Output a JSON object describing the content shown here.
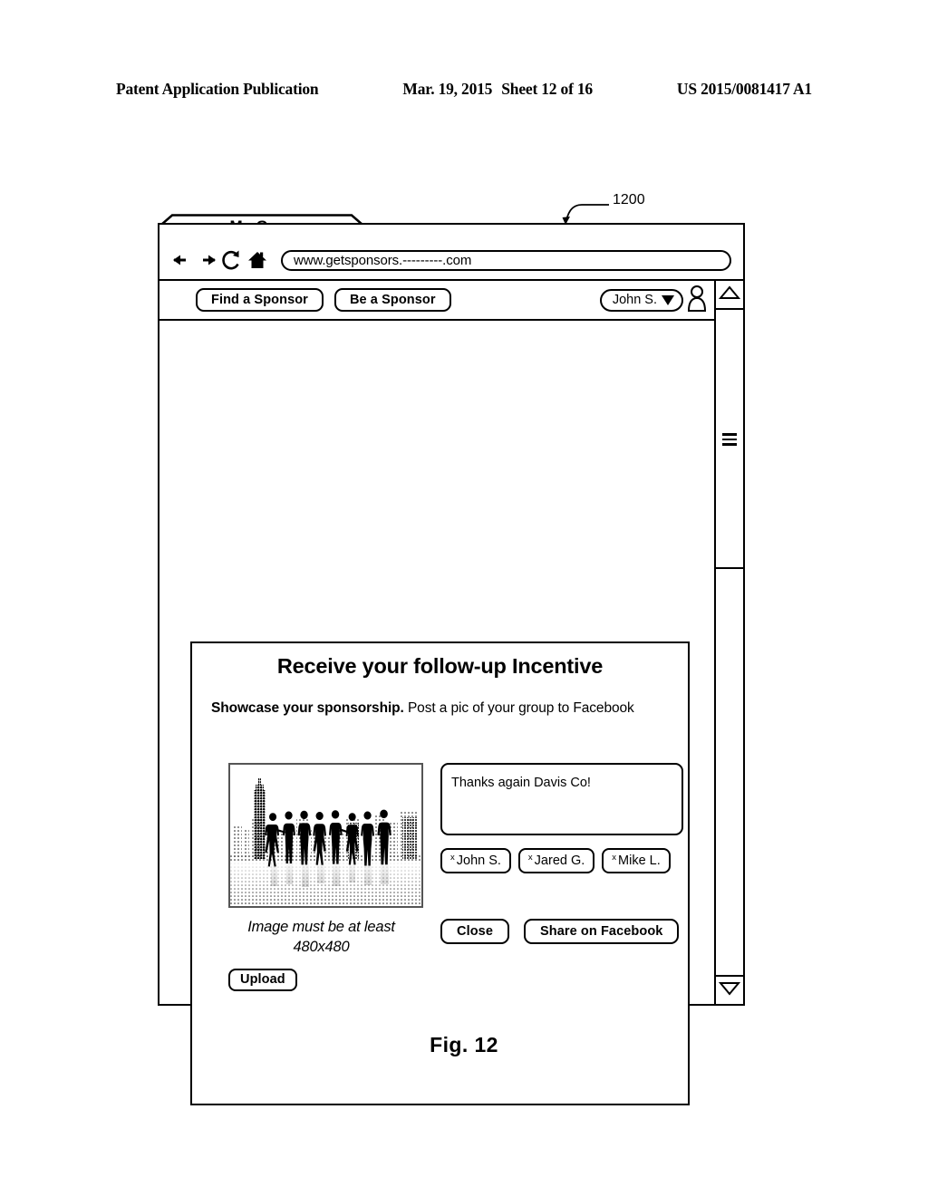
{
  "patent_header": {
    "left": "Patent Application Publication",
    "date": "Mar. 19, 2015",
    "sheet": "Sheet 12 of 16",
    "number": "US 2015/0081417 A1"
  },
  "figure": {
    "caption": "Fig. 12",
    "callout_number": "1200"
  },
  "browser": {
    "tab_label": "My Group",
    "url": "www.getsponsors.---------.com",
    "nav_icons": {
      "back": "back-arrow-icon",
      "forward": "forward-arrow-icon",
      "reload": "reload-icon",
      "home": "home-icon"
    }
  },
  "app_toolbar": {
    "buttons": [
      {
        "label": "Find a Sponsor"
      },
      {
        "label": "Be a Sponsor"
      }
    ],
    "user": {
      "name": "John S.",
      "caret": "chevron-down-icon",
      "avatar": "user-avatar-icon"
    }
  },
  "scrollbar": {
    "up_arrow": "triangle-up-icon",
    "down_arrow": "triangle-down-icon",
    "grip": "grip-lines-icon"
  },
  "dialog": {
    "title": "Receive your follow-up Incentive",
    "subtitle_bold": "Showcase your sponsorship.",
    "subtitle_rest": " Post a pic of your group to Facebook",
    "photo": {
      "alt": "group-silhouette-skyline-photo"
    },
    "image_note": "Image must be at least 480x480",
    "upload_label": "Upload",
    "message": "Thanks again Davis Co!",
    "tags": [
      {
        "remove": "x",
        "name": "John S."
      },
      {
        "remove": "x",
        "name": "Jared G."
      },
      {
        "remove": "x",
        "name": "Mike L."
      }
    ],
    "actions": [
      {
        "label": "Close"
      },
      {
        "label": "Share on Facebook"
      }
    ]
  }
}
